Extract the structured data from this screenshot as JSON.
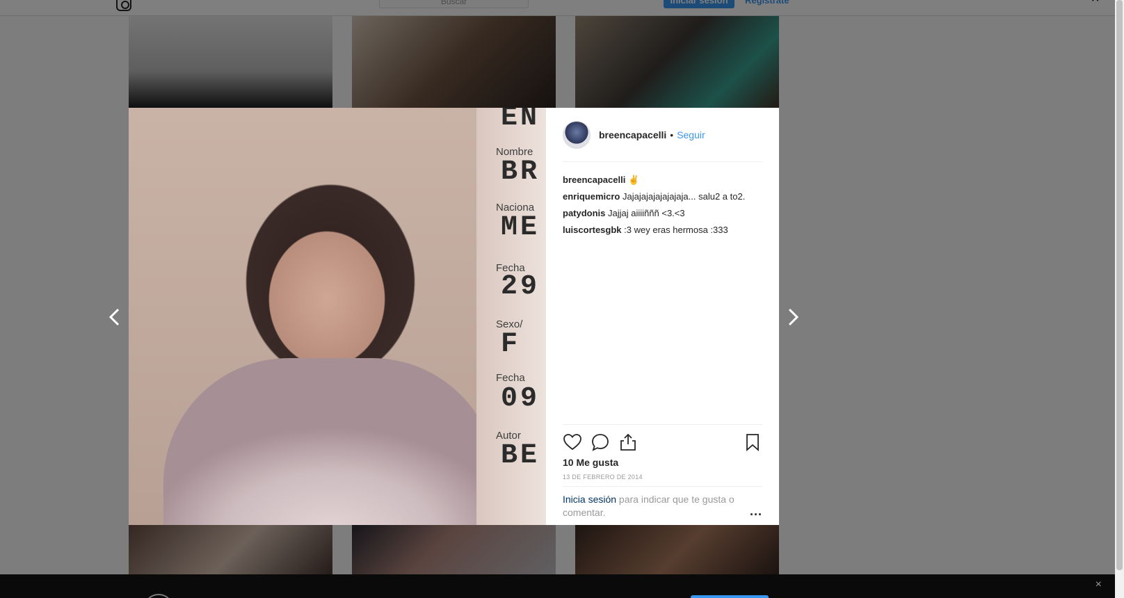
{
  "topbar": {
    "search_placeholder": "Buscar",
    "login_label": "Iniciar sesión",
    "register_label": "Regístrate"
  },
  "post": {
    "username": "breencapacelli",
    "follow_label": "Seguir",
    "separator": "•",
    "caption_user": "breencapacelli",
    "caption_text": "✌",
    "comments": [
      {
        "user": "enriquemicro",
        "text": "Jajajajajajajajaja... salu2 a to2."
      },
      {
        "user": "patydonis",
        "text": "Jajjaj aiiiiñññ <3.<3"
      },
      {
        "user": "luiscortesgbk",
        "text": ":3 wey eras hermosa :333"
      }
    ],
    "likes": "10 Me gusta",
    "date": "13 de febrero de 2014",
    "login_link": "Inicia sesión",
    "login_text": " para indicar que te gusta o comentar.",
    "more_label": "..."
  },
  "photo_text": {
    "line1": "EN",
    "label_nombre": "Nombre",
    "val_nombre": "BR",
    "label_nac": "Naciona",
    "val_nac": "ME",
    "label_fecha": "Fecha",
    "val_fecha": "29",
    "label_sexo": "Sexo/",
    "val_sexo": "F",
    "label_fecha2": "Fecha",
    "val_fecha2": "09",
    "label_autor": "Autor",
    "val_autor": "BE"
  },
  "banner": {
    "close_label": "×"
  },
  "icons": {
    "prev": "chevron-left-icon",
    "next": "chevron-right-icon",
    "like": "heart-icon",
    "comment": "comment-icon",
    "share": "share-icon",
    "save": "bookmark-icon"
  },
  "colors": {
    "accent": "#3897f0",
    "overlay": "rgba(0,0,0,0.5)"
  }
}
